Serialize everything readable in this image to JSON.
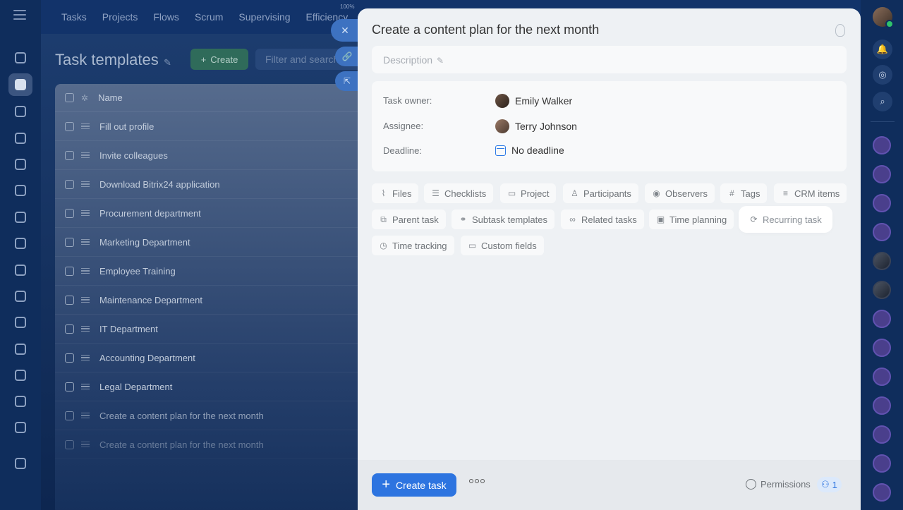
{
  "topbar": {
    "tabs": [
      "Tasks",
      "Projects",
      "Flows",
      "Scrum",
      "Supervising",
      "Efficiency"
    ],
    "efficiency_percent": "100%"
  },
  "background_page": {
    "title": "Task templates",
    "create_label": "Create",
    "filter_placeholder": "Filter and search",
    "grid_header": "Name",
    "rows": [
      "Fill out profile",
      "Invite colleagues",
      "Download Bitrix24 application",
      "Procurement department",
      "Marketing Department",
      "Employee Training",
      "Maintenance Department",
      "IT Department",
      "Accounting Department",
      "Legal Department",
      "Create a content plan for the next month",
      "Create a content plan for the next month"
    ]
  },
  "panel": {
    "title": "Create a content plan for the next month",
    "description_placeholder": "Description",
    "fields": {
      "owner_label": "Task owner:",
      "owner_value": "Emily Walker",
      "assignee_label": "Assignee:",
      "assignee_value": "Terry Johnson",
      "deadline_label": "Deadline:",
      "deadline_value": "No deadline"
    },
    "chips": [
      {
        "label": "Files",
        "icon": "paperclip-icon"
      },
      {
        "label": "Checklists",
        "icon": "checklist-icon"
      },
      {
        "label": "Project",
        "icon": "folder-icon"
      },
      {
        "label": "Participants",
        "icon": "person-icon"
      },
      {
        "label": "Observers",
        "icon": "eye-icon"
      },
      {
        "label": "Tags",
        "icon": "hash-icon"
      },
      {
        "label": "CRM items",
        "icon": "crm-icon"
      },
      {
        "label": "Parent task",
        "icon": "parent-task-icon"
      },
      {
        "label": "Subtask templates",
        "icon": "subtask-icon"
      },
      {
        "label": "Related tasks",
        "icon": "link-icon"
      },
      {
        "label": "Time planning",
        "icon": "calendar-clock-icon"
      },
      {
        "label": "Recurring task",
        "icon": "repeat-icon"
      },
      {
        "label": "Time tracking",
        "icon": "stopwatch-icon"
      },
      {
        "label": "Custom fields",
        "icon": "fields-icon"
      }
    ],
    "footer": {
      "create_task_label": "Create task",
      "permissions_label": "Permissions",
      "permissions_count": "1"
    }
  },
  "colors": {
    "accent": "#2d74e0",
    "background": "#0c2a57"
  }
}
